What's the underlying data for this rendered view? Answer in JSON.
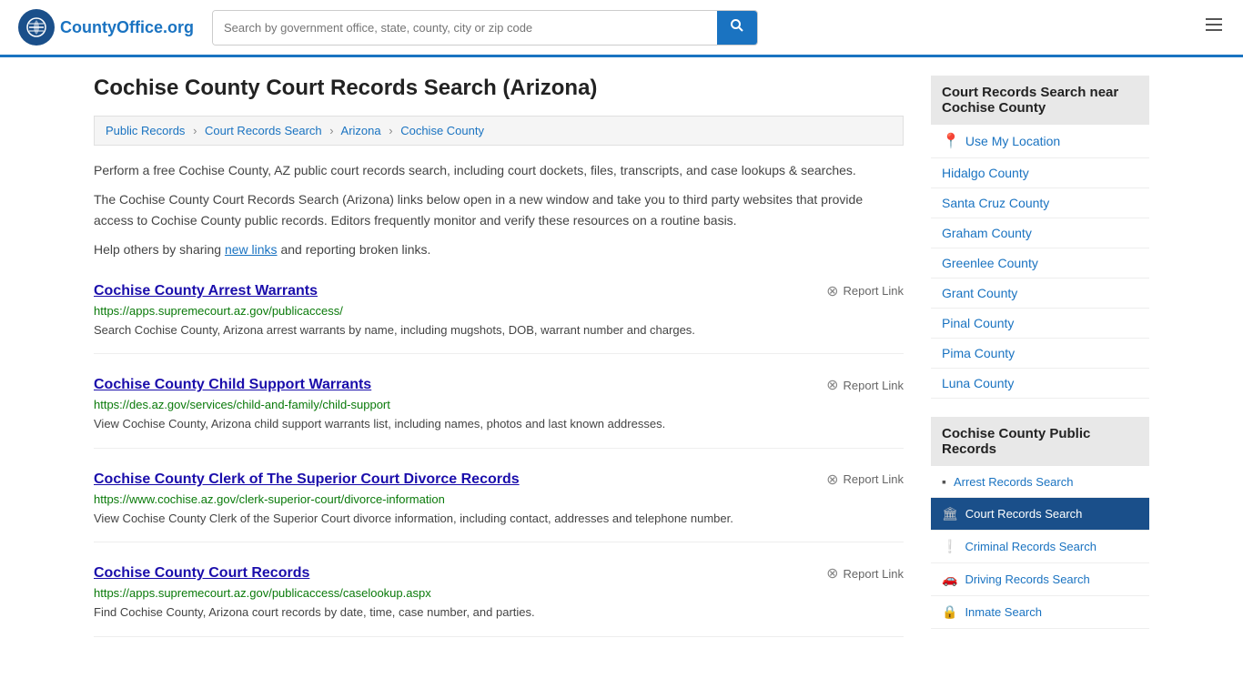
{
  "header": {
    "logo_text": "County",
    "logo_org": "Office",
    "logo_domain": ".org",
    "search_placeholder": "Search by government office, state, county, city or zip code",
    "search_button_label": "🔍"
  },
  "page": {
    "title": "Cochise County Court Records Search (Arizona)",
    "breadcrumbs": [
      {
        "label": "Public Records",
        "href": "#"
      },
      {
        "label": "Court Records Search",
        "href": "#"
      },
      {
        "label": "Arizona",
        "href": "#"
      },
      {
        "label": "Cochise County",
        "href": "#"
      }
    ],
    "description1": "Perform a free Cochise County, AZ public court records search, including court dockets, files, transcripts, and case lookups & searches.",
    "description2": "The Cochise County Court Records Search (Arizona) links below open in a new window and take you to third party websites that provide access to Cochise County public records. Editors frequently monitor and verify these resources on a routine basis.",
    "description3_prefix": "Help others by sharing ",
    "description3_link": "new links",
    "description3_suffix": " and reporting broken links."
  },
  "results": [
    {
      "title": "Cochise County Arrest Warrants",
      "url": "https://apps.supremecourt.az.gov/publicaccess/",
      "description": "Search Cochise County, Arizona arrest warrants by name, including mugshots, DOB, warrant number and charges.",
      "report_label": "Report Link"
    },
    {
      "title": "Cochise County Child Support Warrants",
      "url": "https://des.az.gov/services/child-and-family/child-support",
      "description": "View Cochise County, Arizona child support warrants list, including names, photos and last known addresses.",
      "report_label": "Report Link"
    },
    {
      "title": "Cochise County Clerk of The Superior Court Divorce Records",
      "url": "https://www.cochise.az.gov/clerk-superior-court/divorce-information",
      "description": "View Cochise County Clerk of the Superior Court divorce information, including contact, addresses and telephone number.",
      "report_label": "Report Link"
    },
    {
      "title": "Cochise County Court Records",
      "url": "https://apps.supremecourt.az.gov/publicaccess/caselookup.aspx",
      "description": "Find Cochise County, Arizona court records by date, time, case number, and parties.",
      "report_label": "Report Link"
    }
  ],
  "sidebar": {
    "nearby_section_title": "Court Records Search near Cochise County",
    "use_location_label": "Use My Location",
    "nearby_counties": [
      {
        "label": "Hidalgo County",
        "href": "#"
      },
      {
        "label": "Santa Cruz County",
        "href": "#"
      },
      {
        "label": "Graham County",
        "href": "#"
      },
      {
        "label": "Greenlee County",
        "href": "#"
      },
      {
        "label": "Grant County",
        "href": "#"
      },
      {
        "label": "Pinal County",
        "href": "#"
      },
      {
        "label": "Pima County",
        "href": "#"
      },
      {
        "label": "Luna County",
        "href": "#"
      }
    ],
    "public_records_title": "Cochise County Public Records",
    "public_records_items": [
      {
        "label": "Arrest Records Search",
        "icon": "▪",
        "active": false
      },
      {
        "label": "Court Records Search",
        "icon": "🏛",
        "active": true
      },
      {
        "label": "Criminal Records Search",
        "icon": "❕",
        "active": false
      },
      {
        "label": "Driving Records Search",
        "icon": "🚗",
        "active": false
      },
      {
        "label": "Inmate Search",
        "icon": "🔒",
        "active": false
      }
    ]
  }
}
